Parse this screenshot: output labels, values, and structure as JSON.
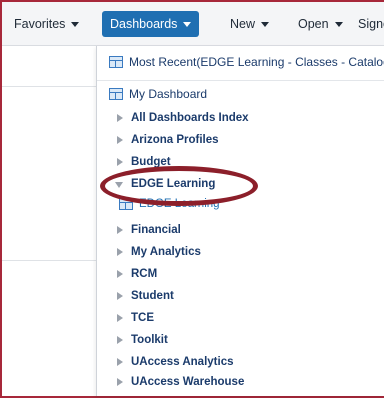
{
  "nav": {
    "favorites": "Favorites",
    "dashboards": "Dashboards",
    "new": "New",
    "open": "Open",
    "signed": "Signe"
  },
  "menu": {
    "most_recent": "Most Recent(EDGE Learning - Classes - Catalog)",
    "my_dashboard": "My Dashboard",
    "folders": [
      {
        "label": "All Dashboards Index",
        "expanded": false
      },
      {
        "label": "Arizona Profiles",
        "expanded": false
      },
      {
        "label": "Budget",
        "expanded": false
      },
      {
        "label": "EDGE Learning",
        "expanded": true
      },
      {
        "label": "Financial",
        "expanded": false
      },
      {
        "label": "My Analytics",
        "expanded": false
      },
      {
        "label": "RCM",
        "expanded": false
      },
      {
        "label": "Student",
        "expanded": false
      },
      {
        "label": "TCE",
        "expanded": false
      },
      {
        "label": "Toolkit",
        "expanded": false
      },
      {
        "label": "UAccess Analytics",
        "expanded": false
      },
      {
        "label": "UAccess Warehouse",
        "expanded": false
      }
    ],
    "edge_child": "EDGE Learning"
  },
  "colors": {
    "accent": "#1f6fb2",
    "frame": "#a7283a",
    "highlight": "#8c1f2a"
  }
}
